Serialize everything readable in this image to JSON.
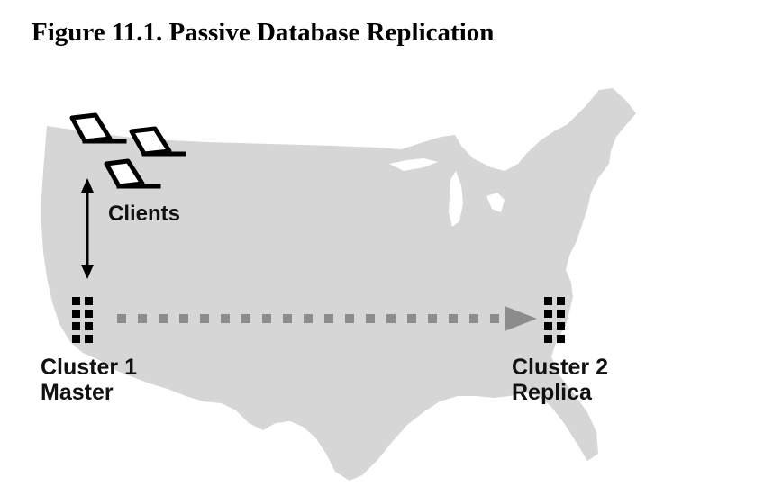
{
  "figure": {
    "title": "Figure 11.1. Passive Database Replication"
  },
  "labels": {
    "clients": "Clients",
    "cluster1_name": "Cluster 1",
    "cluster1_role": "Master",
    "cluster2_name": "Cluster 2",
    "cluster2_role": "Replica"
  },
  "colors": {
    "map": "#d6d6d6",
    "ink": "#000000",
    "replication_arrow": "#8c8c8c"
  },
  "icons": {
    "clients": "laptop-icon",
    "cluster": "server-cluster-icon",
    "map": "usa-map"
  }
}
